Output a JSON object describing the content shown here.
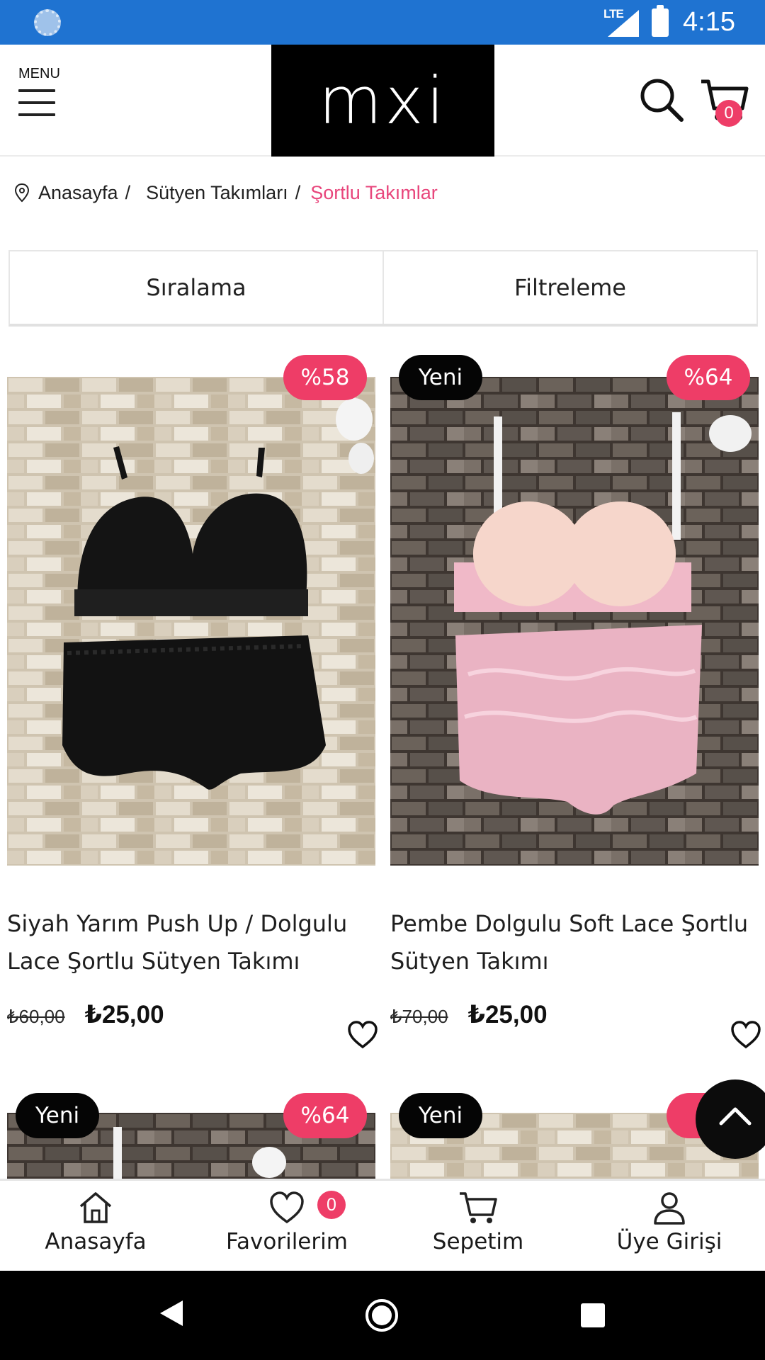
{
  "status_bar": {
    "network": "LTE",
    "time": "4:15"
  },
  "header": {
    "menu_label": "MENU",
    "logo_text": "mxi",
    "cart_count": "0"
  },
  "breadcrumb": {
    "items": [
      "Anasayfa",
      "Sütyen Takımları",
      "Şortlu Takımlar"
    ],
    "separator": "/"
  },
  "toolbar": {
    "sort_label": "Sıralama",
    "filter_label": "Filtreleme"
  },
  "products": [
    {
      "title": "Siyah Yarım Push Up / Dolgulu Lace Şortlu Sütyen Takımı",
      "discount_badge": "%58",
      "new_badge": "",
      "old_price": "₺60,00",
      "price": "₺25,00",
      "image_theme": "black lace set on light stone wall"
    },
    {
      "title": "Pembe Dolgulu Soft Lace Şortlu Sütyen Takımı",
      "discount_badge": "%64",
      "new_badge": "Yeni",
      "old_price": "₺70,00",
      "price": "₺25,00",
      "image_theme": "pink lace set on dark stone wall"
    },
    {
      "title": "",
      "discount_badge": "%64",
      "new_badge": "Yeni"
    },
    {
      "title": "",
      "discount_badge": "%",
      "new_badge": "Yeni"
    }
  ],
  "bottom_nav": {
    "items": [
      {
        "label": "Anasayfa",
        "icon": "home-icon"
      },
      {
        "label": "Favorilerim",
        "icon": "heart-icon",
        "badge": "0"
      },
      {
        "label": "Sepetim",
        "icon": "cart-icon"
      },
      {
        "label": "Üye Girişi",
        "icon": "user-icon"
      }
    ]
  },
  "colors": {
    "accent": "#ee3d67",
    "breadcrumb_current": "#e8467c",
    "status_bar": "#1f73d1"
  }
}
